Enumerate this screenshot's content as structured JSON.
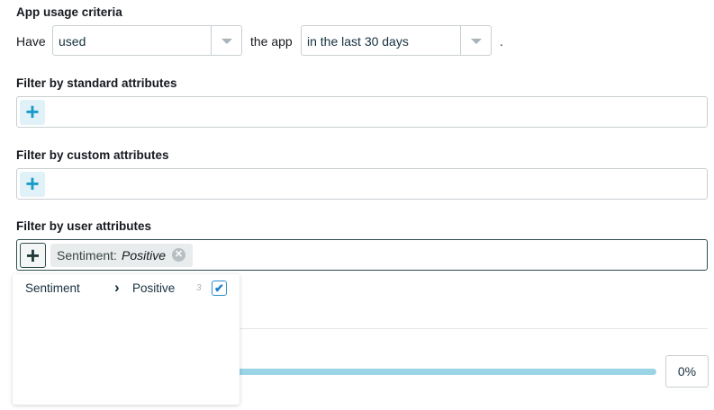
{
  "app_usage": {
    "title": "App usage criteria",
    "have": "Have",
    "action_value": "used",
    "the_app": "the app",
    "period_value": "in the last 30 days",
    "period_end": "."
  },
  "standard": {
    "title": "Filter by standard attributes",
    "add": "+"
  },
  "custom": {
    "title": "Filter by custom attributes",
    "add": "+"
  },
  "user": {
    "title": "Filter by user attributes",
    "add": "+",
    "chip_key": "Sentiment:",
    "chip_value": "Positive"
  },
  "dropdown": {
    "attribute": "Sentiment",
    "arrow": "›",
    "value": "Positive",
    "count": "3",
    "checked": true
  },
  "slider": {
    "value_percent": 0,
    "label": "0%"
  },
  "colors": {
    "accent": "#1a9cc9",
    "slider": "#9ad4e6",
    "dark": "#1f3b3b"
  }
}
